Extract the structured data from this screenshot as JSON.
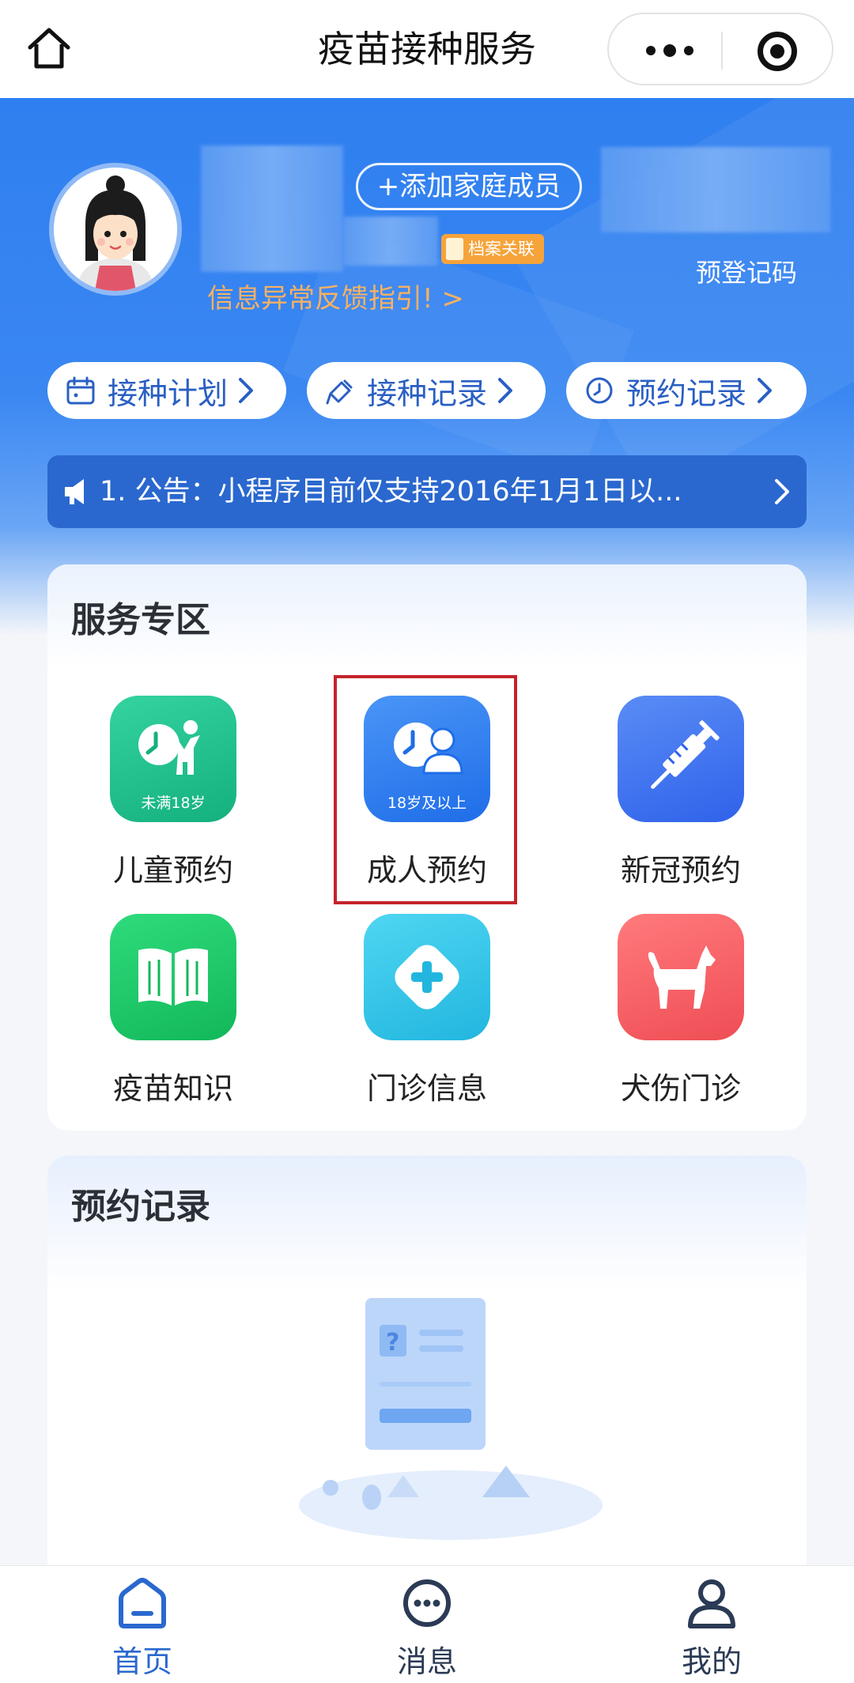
{
  "navbar": {
    "title": "疫苗接种服务",
    "home_icon": "home-icon",
    "more_icon": "more-dots-icon",
    "close_icon": "target-circle-icon"
  },
  "profile": {
    "add_family_label": "+添加家庭成员",
    "archive_badge": "档案关联",
    "precode_label": "预登记码",
    "feedback_label": "信息异常反馈指引! >"
  },
  "quick_links": [
    {
      "label": "接种计划",
      "icon": "calendar-icon"
    },
    {
      "label": "接种记录",
      "icon": "syringe-tag-icon"
    },
    {
      "label": "预约记录",
      "icon": "clock-icon"
    }
  ],
  "notice": {
    "text": "1. 公告：小程序目前仅支持2016年1月1日以...",
    "icon": "megaphone-icon"
  },
  "service_section": {
    "title": "服务专区",
    "items": [
      {
        "label": "儿童预约",
        "sub": "未满18岁",
        "icon": "child-clock-icon",
        "color": "#1fbf8f"
      },
      {
        "label": "成人预约",
        "sub": "18岁及以上",
        "icon": "adult-clock-icon",
        "color": "#2f7ff0"
      },
      {
        "label": "新冠预约",
        "sub": "",
        "icon": "syringe-icon",
        "color": "#3e6ff2"
      },
      {
        "label": "疫苗知识",
        "sub": "",
        "icon": "book-icon",
        "color": "#1fcf6a"
      },
      {
        "label": "门诊信息",
        "sub": "",
        "icon": "plus-clinic-icon",
        "color": "#31c6e8"
      },
      {
        "label": "犬伤门诊",
        "sub": "",
        "icon": "dog-icon",
        "color": "#f25a5f"
      }
    ]
  },
  "record_section": {
    "title": "预约记录",
    "empty_icon": "empty-document-icon"
  },
  "tabbar": [
    {
      "label": "首页",
      "icon": "home-tab-icon",
      "active": true
    },
    {
      "label": "消息",
      "icon": "message-icon",
      "active": false
    },
    {
      "label": "我的",
      "icon": "user-icon",
      "active": false
    }
  ],
  "colors": {
    "primary": "#2f7ff0",
    "accent_orange": "#f7b162",
    "highlight_red": "#c4232b",
    "tab_active": "#2a68cf",
    "tab_inactive": "#2b3a55"
  }
}
